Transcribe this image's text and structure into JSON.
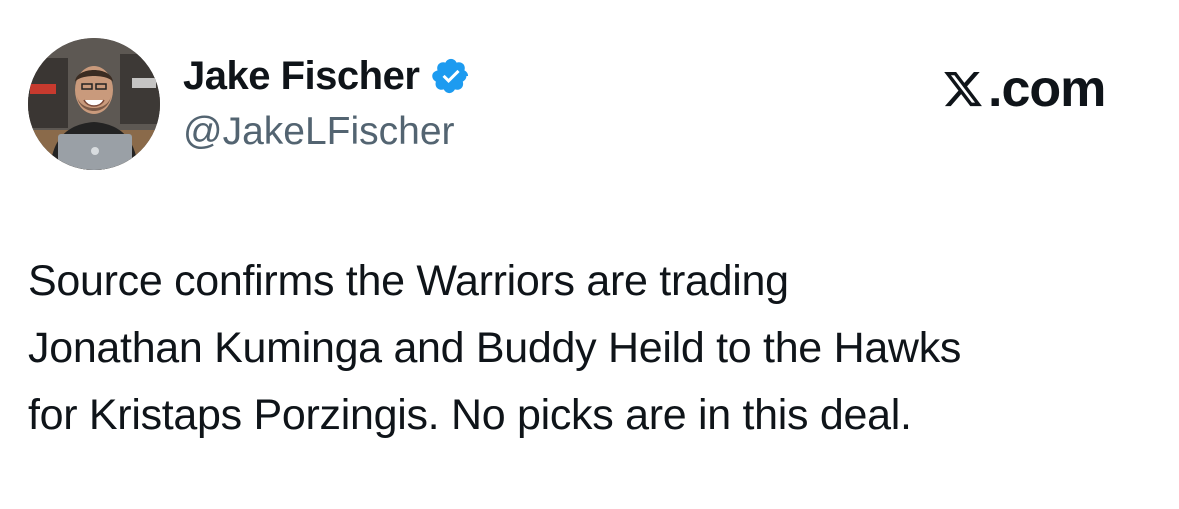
{
  "author": {
    "name": "Jake Fischer",
    "handle": "@JakeLFischer",
    "verified": true,
    "avatar_icon": "profile-photo"
  },
  "site": {
    "logo_icon": "x-logo-icon",
    "domain_text": ".com"
  },
  "tweet": {
    "lines": [
      "Source confirms the Warriors are trading",
      "Jonathan Kuminga and Buddy Heild to the Hawks",
      "for Kristaps Porzingis. No picks are in this deal."
    ]
  },
  "colors": {
    "text_primary": "#0f1419",
    "text_secondary": "#536471",
    "verified_blue": "#1d9bf0",
    "background": "#ffffff"
  }
}
